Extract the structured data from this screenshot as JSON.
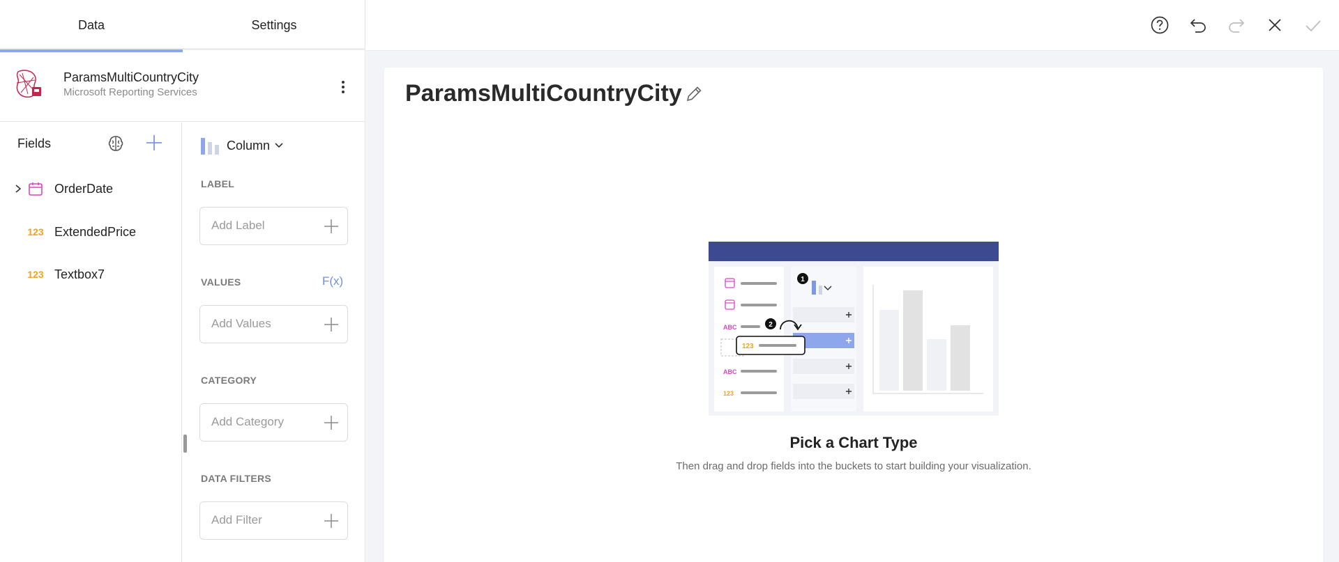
{
  "tabs": [
    {
      "label": "Data",
      "active": true
    },
    {
      "label": "Settings",
      "active": false
    }
  ],
  "datasource": {
    "name": "ParamsMultiCountryCity",
    "type": "Microsoft Reporting Services",
    "logo_icon": "ssrs-logo-icon"
  },
  "fields_panel": {
    "title": "Fields",
    "fields": [
      {
        "name": "OrderDate",
        "type": "date",
        "expandable": true
      },
      {
        "name": "ExtendedPrice",
        "type": "number",
        "type_badge": "123"
      },
      {
        "name": "Textbox7",
        "type": "number",
        "type_badge": "123"
      }
    ]
  },
  "buckets_panel": {
    "chart_type": "Column",
    "label": {
      "title": "LABEL",
      "placeholder": "Add Label"
    },
    "values": {
      "title": "VALUES",
      "formula": "F(x)",
      "placeholder": "Add Values"
    },
    "category": {
      "title": "CATEGORY",
      "placeholder": "Add Category"
    },
    "filters": {
      "title": "DATA FILTERS",
      "placeholder": "Add Filter"
    }
  },
  "toolbar": {
    "icons": [
      "help-icon",
      "undo-icon",
      "redo-icon",
      "close-icon",
      "confirm-icon"
    ]
  },
  "visualization": {
    "title": "ParamsMultiCountryCity",
    "empty_state": {
      "title": "Pick a Chart Type",
      "subtitle": "Then drag and drop fields into the buckets to start building your visualization.",
      "step_1": "1",
      "step_2": "2",
      "badge_abc": "ABC",
      "badge_num": "123"
    }
  },
  "colors": {
    "accent": "#8ea7ec",
    "number_type": "#f4a11c",
    "date_type": "#e040c8",
    "illustration_header": "#3d4a8f",
    "brand_red": "#c8234f"
  }
}
